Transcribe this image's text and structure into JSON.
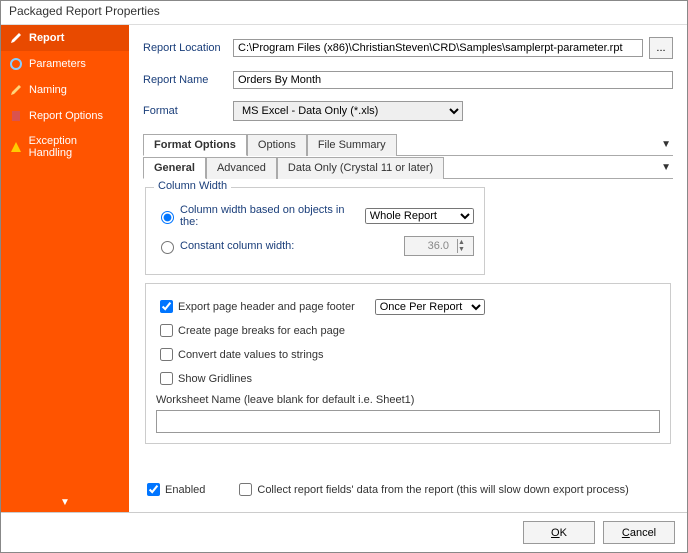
{
  "title": "Packaged Report Properties",
  "sidebar": {
    "items": [
      {
        "label": "Report"
      },
      {
        "label": "Parameters"
      },
      {
        "label": "Naming"
      },
      {
        "label": "Report Options"
      },
      {
        "label": "Exception Handling"
      }
    ]
  },
  "fields": {
    "location_label": "Report Location",
    "location_value": "C:\\Program Files (x86)\\ChristianSteven\\CRD\\Samples\\samplerpt-parameter.rpt",
    "name_label": "Report Name",
    "name_value": "Orders By Month",
    "format_label": "Format",
    "format_value": "MS Excel - Data Only (*.xls)"
  },
  "tabs": {
    "t1": "Format Options",
    "t2": "Options",
    "t3": "File Summary"
  },
  "subtabs": {
    "s1": "General",
    "s2": "Advanced",
    "s3": "Data Only (Crystal 11 or later)"
  },
  "colwidth": {
    "legend": "Column Width",
    "opt1": "Column width based on objects in the:",
    "opt1_select": "Whole Report",
    "opt2": "Constant column width:",
    "opt2_value": "36.0"
  },
  "checks": {
    "export_hf": "Export page header and page footer",
    "export_hf_select": "Once Per Report",
    "page_breaks": "Create page breaks for each page",
    "date_strings": "Convert date values to strings",
    "gridlines": "Show Gridlines",
    "wsname_label": "Worksheet Name (leave blank for default i.e. Sheet1)"
  },
  "bottom": {
    "enabled": "Enabled",
    "collect": "Collect report fields' data from the report (this will slow down export process)"
  },
  "footer": {
    "ok": "OK",
    "cancel": "Cancel"
  }
}
